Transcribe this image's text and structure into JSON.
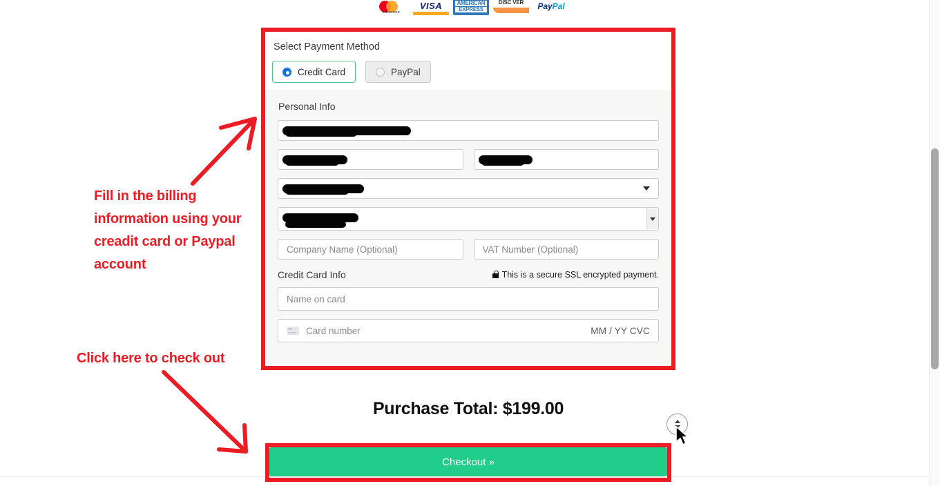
{
  "payment_logos": [
    {
      "name": "mastercard-logo",
      "label": "mastercard"
    },
    {
      "name": "visa-logo",
      "label": "VISA"
    },
    {
      "name": "amex-logo",
      "label_line1": "AMERICAN",
      "label_line2": "EXPRESS"
    },
    {
      "name": "discover-logo",
      "label": "DISC VER"
    },
    {
      "name": "paypal-logo",
      "label_part1": "Pay",
      "label_part2": "Pal"
    }
  ],
  "form": {
    "select_payment_label": "Select Payment Method",
    "methods": [
      {
        "label": "Credit Card",
        "selected": true
      },
      {
        "label": "PayPal",
        "selected": false
      }
    ],
    "personal_info_label": "Personal Info",
    "fields": {
      "email_value": "",
      "first_name_value": "",
      "last_name_value": "",
      "country_value": "",
      "state_value": "",
      "company_placeholder": "Company Name (Optional)",
      "vat_placeholder": "VAT Number (Optional)"
    },
    "credit_card_info_label": "Credit Card Info",
    "ssl_note": "This is a secure SSL encrypted payment.",
    "name_on_card_placeholder": "Name on card",
    "card_number_placeholder": "Card number",
    "card_expiry_cvc": "MM / YY  CVC"
  },
  "purchase_total": "Purchase Total: $199.00",
  "checkout_label": "Checkout »",
  "annotations": {
    "billing_note": "Fill in the billing information using your creadit card or Paypal account",
    "checkout_note": "Click here to check out"
  },
  "colors": {
    "annotation_red": "#ec1c24",
    "checkout_green": "#21ce89",
    "selected_border_green": "#4fc48a",
    "radio_blue": "#1273e6"
  }
}
